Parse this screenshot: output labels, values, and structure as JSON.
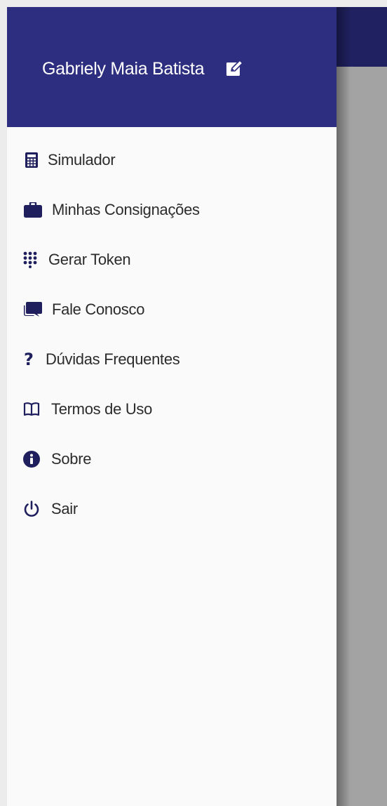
{
  "drawer": {
    "user_name": "Gabriely Maia Batista",
    "edit_icon": "edit-icon",
    "items": [
      {
        "label": "Simulador",
        "icon": "calculator-icon"
      },
      {
        "label": "Minhas Consignações",
        "icon": "briefcase-icon"
      },
      {
        "label": "Gerar Token",
        "icon": "dialpad-icon"
      },
      {
        "label": "Fale Conosco",
        "icon": "chat-icon"
      },
      {
        "label": "Dúvidas Frequentes",
        "icon": "question-icon",
        "glyph": "?"
      },
      {
        "label": "Termos de Uso",
        "icon": "book-icon"
      },
      {
        "label": "Sobre",
        "icon": "info-icon"
      },
      {
        "label": "Sair",
        "icon": "power-icon"
      }
    ]
  },
  "colors": {
    "header": "#2d2e80",
    "topbar": "#1f2160",
    "icon": "#1e1f5c",
    "drawer_bg": "#fafafa",
    "scrim": "#a3a3a3"
  }
}
